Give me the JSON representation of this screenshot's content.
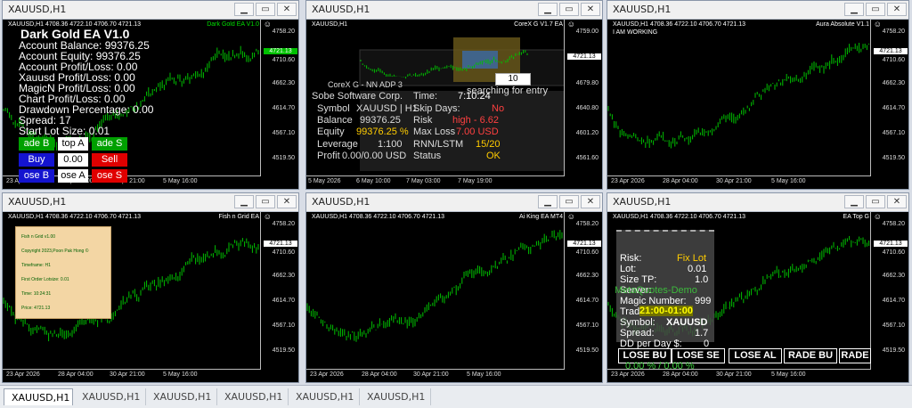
{
  "windows": [
    {
      "title": "XAUUSD,H1",
      "header": "XAUUSD,H1  4708.36 4722.10 4706.70 4721.13",
      "ea_label": "Dark Gold EA V1.0",
      "prices": [
        "4758.20",
        "4710.60",
        "4662.30",
        "4614.70",
        "4567.10",
        "4519.50"
      ],
      "current_price": "4721.13",
      "times": [
        "23 Apr 2026",
        "28 Apr 04:00",
        "30 Apr 21:00",
        "5 May 16:00"
      ]
    },
    {
      "title": "XAUUSD,H1",
      "header": "XAUUSD,H1",
      "ea_label": "CoreX G V1.7 EA",
      "prices": [
        "4759.00",
        "4721.13",
        "4679.80",
        "4640.80",
        "4601.20",
        "4561.60"
      ],
      "current_price": "4721.13",
      "times": [
        "5 May 2026",
        "6 May 10:00",
        "7 May 03:00",
        "7 May 19:00"
      ]
    },
    {
      "title": "XAUUSD,H1",
      "header": "XAUUSD,H1  4708.36 4722.10 4706.70 4721.13",
      "ea_label": "Aura Absolute V1.1",
      "prices": [
        "4758.20",
        "4710.60",
        "4662.30",
        "4614.70",
        "4567.10",
        "4519.50"
      ],
      "current_price": "4721.13",
      "times": [
        "23 Apr 2026",
        "28 Apr 04:00",
        "30 Apr 21:00",
        "5 May 16:00"
      ]
    },
    {
      "title": "XAUUSD,H1",
      "header": "XAUUSD,H1  4708.36 4722.10 4706.70 4721.13",
      "ea_label": "Fish n Grid EA",
      "prices": [
        "4758.20",
        "4710.60",
        "4662.30",
        "4614.70",
        "4567.10",
        "4519.50"
      ],
      "current_price": "4721.13",
      "times": [
        "23 Apr 2026",
        "28 Apr 04:00",
        "30 Apr 21:00",
        "5 May 16:00"
      ]
    },
    {
      "title": "XAUUSD,H1",
      "header": "XAUUSD,H1  4708.36 4722.10 4706.70 4721.13",
      "ea_label": "Ai King EA MT4",
      "prices": [
        "4758.20",
        "4710.60",
        "4662.30",
        "4614.70",
        "4567.10",
        "4519.50"
      ],
      "current_price": "4721.13",
      "times": [
        "23 Apr 2026",
        "28 Apr 04:00",
        "30 Apr 21:00",
        "5 May 16:00"
      ]
    },
    {
      "title": "XAUUSD,H1",
      "header": "XAUUSD,H1  4708.36 4722.10 4706.70 4721.13",
      "ea_label": "EA Top G",
      "prices": [
        "4758.20",
        "4710.60",
        "4662.30",
        "4614.70",
        "4567.10",
        "4519.50"
      ],
      "current_price": "4721.13",
      "times": [
        "23 Apr 2026",
        "28 Apr 04:00",
        "30 Apr 21:00",
        "5 May 16:00"
      ]
    }
  ],
  "dark_gold": {
    "title": "Dark Gold EA V1.0",
    "lines": [
      "Account Balance: 99376.25",
      "Account Equity: 99376.25",
      "Account Profit/Loss: 0.00",
      "Xauusd Profit/Loss: 0.00",
      "MagicN Profit/Loss: 0.00",
      "Chart Profit/Loss: 0.00",
      "Drawdown Percentage: 0.00",
      "Spread: 17",
      "Start Lot Size: 0.01"
    ],
    "buttons": [
      "ade B",
      "top A",
      "ade S",
      "Buy",
      "0.00",
      "Sell",
      "ose B",
      "ose A",
      "ose S"
    ]
  },
  "corex": {
    "status": "searching for entry",
    "number": "10",
    "title": "CoreX G  -  NN ADP 3",
    "company": "Sobe Software Corp.",
    "rows": [
      [
        "Time:",
        "7:10:24"
      ],
      [
        "Symbol",
        "XAUUSD | H1",
        "Skip Days:",
        "No"
      ],
      [
        "Balance",
        "99376.25",
        "Risk",
        "high - 6.62"
      ],
      [
        "Equity",
        "99376.25 %",
        "Max Loss",
        "7.00 USD"
      ],
      [
        "Leverage",
        "1:100",
        "RNN/LSTM",
        "15/20"
      ],
      [
        "Profit",
        "0.00/0.00 USD",
        "Status",
        "OK"
      ]
    ]
  },
  "aura": {
    "status": "I AM WORKING"
  },
  "fish": {
    "lines": [
      "Fish n Grid v1.00",
      "Copyright 2023,Poon Pak Hong ©",
      "Timeframe: H1",
      "First Order Lotsize: 0.01",
      "Time: 10:24:31",
      "Price: 4721.13"
    ]
  },
  "topg": {
    "risk_label": "Risk:",
    "risk_value": "Fix Lot",
    "lot_label": "Lot:",
    "lot_value": "0.01",
    "size_label": "Size TP:",
    "size_value": "1.0",
    "server_label": "Server:",
    "server_value": "MetaQuotes-Demo",
    "magic_label": "Magic Number:",
    "magic_value": "999",
    "trade_label": "Trade:",
    "trade_value": "21:00-01:00",
    "symbol_label": "Symbol:",
    "symbol_value": "XAUUSD",
    "spread_label": "Spread:",
    "spread_value": "1.7",
    "dd_label": "DD per Day $:",
    "dd_value": "0",
    "buttons": [
      "LOSE BU",
      "LOSE SE",
      "LOSE AL",
      "RADE BU",
      "RADE"
    ],
    "pct": "0.00 % / 0.00 %"
  },
  "tabs": [
    "XAUUSD,H1",
    "XAUUSD,H1",
    "XAUUSD,H1",
    "XAUUSD,H1",
    "XAUUSD,H1",
    "XAUUSD,H1"
  ],
  "colors": {
    "candle_up": "#00c000",
    "background": "#000000",
    "titlebar": "#f0f0f0"
  }
}
